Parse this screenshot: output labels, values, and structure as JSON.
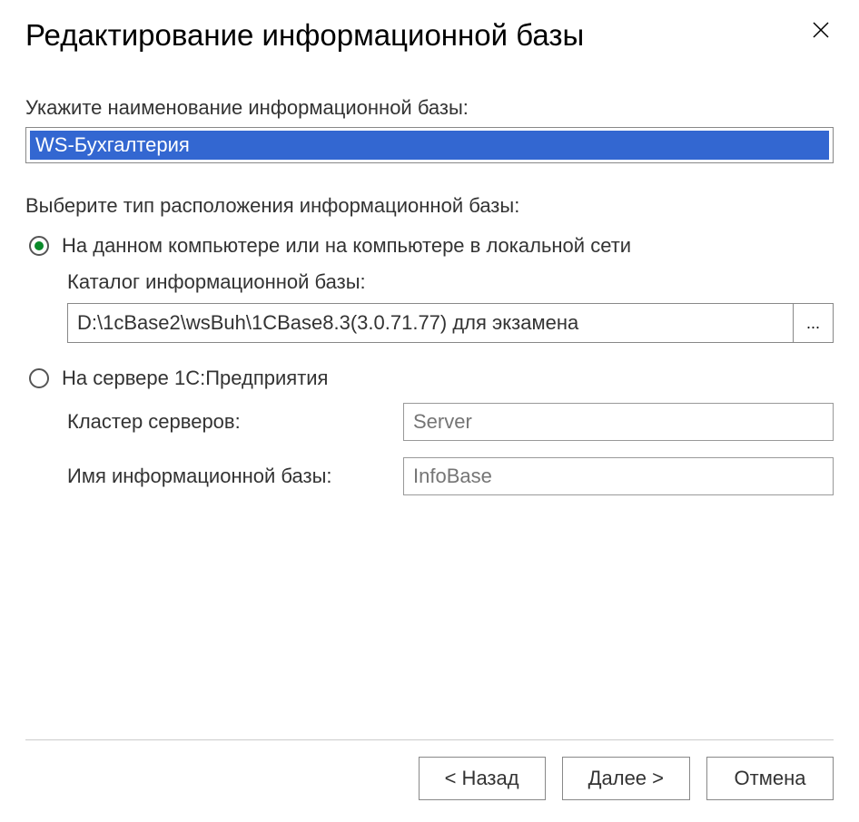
{
  "dialog": {
    "title": "Редактирование информационной базы",
    "name_label": "Укажите наименование информационной базы:",
    "name_value": "WS-Бухгалтерия",
    "location_label": "Выберите тип расположения информационной базы:",
    "option_local": {
      "label": "На данном компьютере или на компьютере в локальной сети",
      "catalog_label": "Каталог информационной базы:",
      "catalog_value": "D:\\1cBase2\\wsBuh\\1CBase8.3(3.0.71.77) для экзамена",
      "browse": "..."
    },
    "option_server": {
      "label": "На сервере 1С:Предприятия",
      "cluster_label": "Кластер серверов:",
      "cluster_placeholder": "Server",
      "infobase_label": "Имя информационной базы:",
      "infobase_placeholder": "InfoBase"
    },
    "buttons": {
      "back": "< Назад",
      "next": "Далее >",
      "cancel": "Отмена"
    }
  }
}
